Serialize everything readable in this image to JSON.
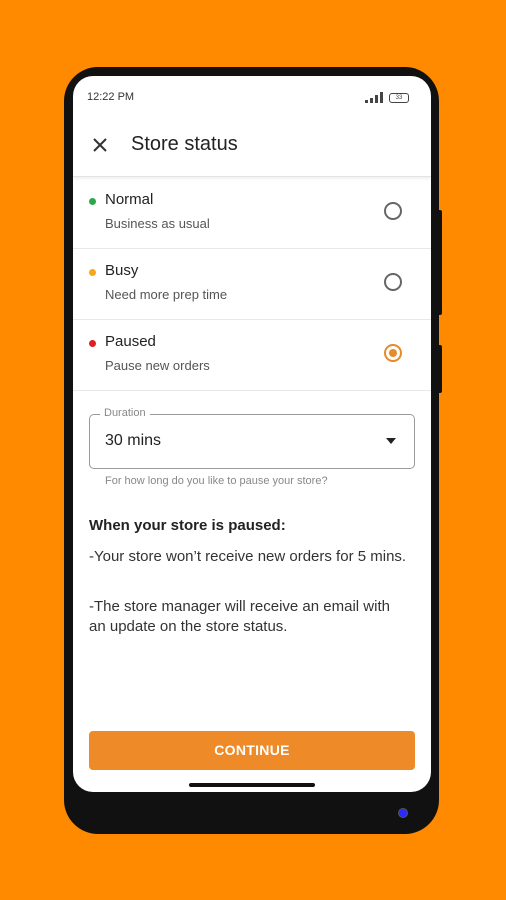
{
  "status_bar": {
    "time": "12:22 PM",
    "battery": "33"
  },
  "header": {
    "title": "Store status"
  },
  "options": [
    {
      "title": "Normal",
      "subtitle": "Business as usual",
      "dot_color": "#2AA84A",
      "selected": false
    },
    {
      "title": "Busy",
      "subtitle": "Need more prep time",
      "dot_color": "#F5A623",
      "selected": false
    },
    {
      "title": "Paused",
      "subtitle": "Pause new orders",
      "dot_color": "#E02020",
      "selected": true
    }
  ],
  "duration": {
    "label": "Duration",
    "value": "30 mins",
    "helper": "For how long do you like to pause your store?"
  },
  "info": {
    "heading": "When your store is paused:",
    "lines": [
      "-Your store won’t receive new orders for 5 mins.",
      "-The store manager will receive an email with an  update on the store status."
    ]
  },
  "continue_label": "CONTINUE",
  "colors": {
    "accent": "#EE8A27",
    "background": "#FF8A00"
  }
}
